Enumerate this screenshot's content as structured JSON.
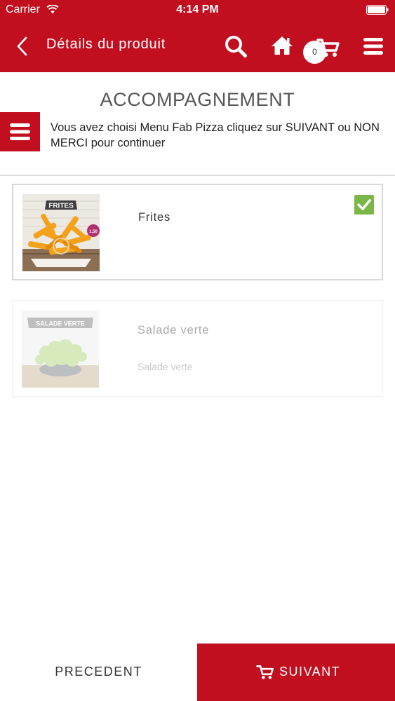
{
  "status_bar": {
    "carrier": "Carrier",
    "time": "4:14 PM"
  },
  "nav": {
    "title": "Détails du produit",
    "cart_count": "0",
    "icons": [
      "back-icon",
      "search-icon",
      "home-icon",
      "cart-icon",
      "menu-icon"
    ]
  },
  "section": {
    "title": "ACCOMPAGNEMENT",
    "instruction": "Vous avez choisi Menu Fab Pizza cliquez sur SUIVANT ou NON MERCI pour continuer"
  },
  "products": [
    {
      "name": "Frites",
      "image_label": "FRITES",
      "price_tag": "1,50",
      "selected": true
    },
    {
      "name": "Salade verte",
      "image_label": "SALADE VERTE",
      "description": "Salade verte",
      "selected": false
    }
  ],
  "footer": {
    "prev_label": "PRECEDENT",
    "next_label": "SUIVANT"
  },
  "colors": {
    "brand_red": "#c20f1f",
    "check_green": "#7ab648"
  }
}
